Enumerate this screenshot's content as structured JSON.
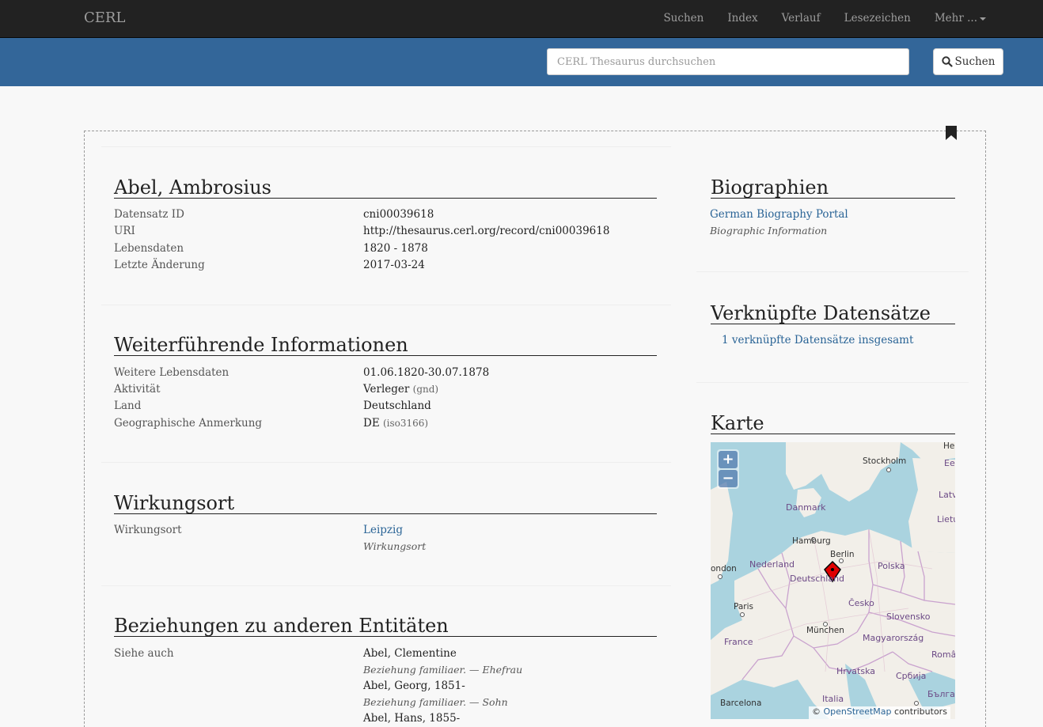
{
  "nav": {
    "brand": "CERL",
    "links": [
      "Suchen",
      "Index",
      "Verlauf",
      "Lesezeichen"
    ],
    "more": "Mehr ..."
  },
  "search": {
    "placeholder": "CERL Thesaurus durchsuchen",
    "button": "Suchen"
  },
  "record": {
    "title": "Abel, Ambrosius",
    "fields": [
      {
        "label": "Datensatz ID",
        "value": "cni00039618"
      },
      {
        "label": "URI",
        "value": "http://thesaurus.cerl.org/record/cni00039618"
      },
      {
        "label": "Lebensdaten",
        "value": "1820 - 1878"
      },
      {
        "label": "Letzte Änderung",
        "value": "2017-03-24"
      }
    ]
  },
  "info": {
    "title": "Weiterführende Informationen",
    "fields": [
      {
        "label": "Weitere Lebensdaten",
        "value": "01.06.1820-30.07.1878",
        "note": ""
      },
      {
        "label": "Aktivität",
        "value": "Verleger",
        "note": "(gnd)"
      },
      {
        "label": "Land",
        "value": "Deutschland",
        "note": ""
      },
      {
        "label": "Geographische Anmerkung",
        "value": "DE",
        "note": "(iso3166)"
      }
    ]
  },
  "place": {
    "title": "Wirkungsort",
    "label": "Wirkungsort",
    "value": "Leipzig",
    "note": "Wirkungsort"
  },
  "relations": {
    "title": "Beziehungen zu anderen Entitäten",
    "label": "Siehe auch",
    "items": [
      {
        "name": "Abel, Clementine",
        "note": "Beziehung familiaer. — Ehefrau"
      },
      {
        "name": "Abel, Georg, 1851-",
        "note": "Beziehung familiaer. — Sohn"
      },
      {
        "name": "Abel, Hans, 1855-",
        "note": ""
      }
    ]
  },
  "sidebar": {
    "bio_title": "Biographien",
    "bio_link": "German Biography Portal",
    "bio_note": "Biographic Information",
    "linked_title": "Verknüpfte Datensätze",
    "linked_link": "1 verknüpfte Datensätze insgesamt",
    "map_title": "Karte"
  },
  "map": {
    "zoom_in": "+",
    "zoom_out": "−",
    "attribution_prefix": "©",
    "attribution_link": "OpenStreetMap",
    "attribution_suffix": "contributors",
    "labels": {
      "helsinki": "Helsin",
      "stockholm": "Stockholm",
      "eesti": "Eesti",
      "latvija": "Latvija",
      "danmark": "Danmark",
      "lietuva": "Lietuva",
      "hamburg": "Hamburg",
      "berlin": "Berlin",
      "london": "ondon",
      "nederland": "Nederland",
      "deutschland": "Deutschland",
      "polska": "Polska",
      "paris": "Paris",
      "cesko": "Česko",
      "slovensko": "Slovensko",
      "munchen": "München",
      "france": "France",
      "magyarorszag": "Magyarország",
      "romania": "Români",
      "hrvatska": "Hrvatska",
      "srbija": "Србија",
      "barcelona": "Barcelona",
      "italia": "Italia",
      "bulgaria": "Бълга"
    },
    "colors": {
      "sea": "#aad3df",
      "land": "#f2efe9",
      "border": "#c090c8",
      "marker": "#e00000"
    }
  }
}
